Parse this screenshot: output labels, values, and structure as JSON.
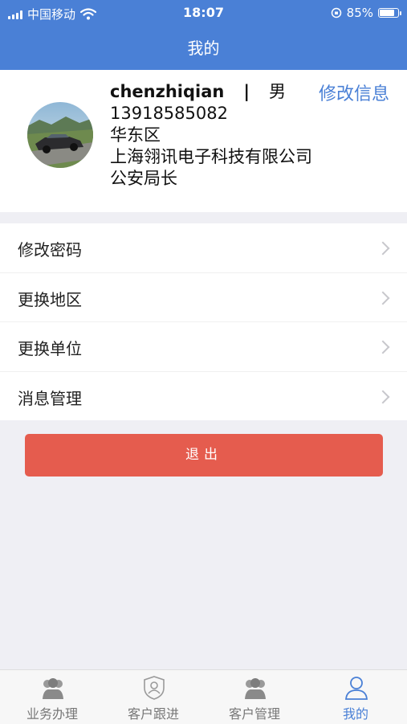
{
  "status_bar": {
    "carrier": "中国移动",
    "time": "18:07",
    "battery": "85%"
  },
  "nav": {
    "title": "我的"
  },
  "profile": {
    "username": "chenzhiqian",
    "separator": "|",
    "gender": "男",
    "phone": "13918585082",
    "region": "华东区",
    "company": "上海翎讯电子科技有限公司",
    "position": "公安局长",
    "edit_label": "修改信息"
  },
  "menu": {
    "items": [
      {
        "label": "修改密码"
      },
      {
        "label": "更换地区"
      },
      {
        "label": "更换单位"
      },
      {
        "label": "消息管理"
      }
    ]
  },
  "logout": {
    "label": "退出"
  },
  "tabbar": {
    "items": [
      {
        "label": "业务办理",
        "icon": "people-icon"
      },
      {
        "label": "客户跟进",
        "icon": "shield-user-icon"
      },
      {
        "label": "客户管理",
        "icon": "people-icon"
      },
      {
        "label": "我的",
        "icon": "person-icon",
        "active": true
      }
    ]
  },
  "colors": {
    "primary": "#4a80d6",
    "logout": "#e55c4e",
    "background": "#efeff4"
  }
}
